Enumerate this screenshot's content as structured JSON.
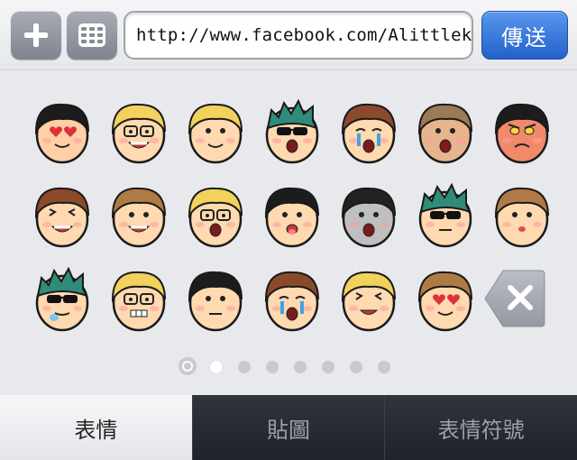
{
  "toolbar": {
    "url_value": "http://www.facebook.com/Alittlekeke",
    "send_label": "傳送"
  },
  "stickers": [
    {
      "hair": "#1c1c1c",
      "skin": "#ffcfa6",
      "expression": "heart-eyes"
    },
    {
      "hair": "#f2d15c",
      "skin": "#ffd9b0",
      "expression": "glasses-laugh"
    },
    {
      "hair": "#f2d15c",
      "skin": "#ffd9b0",
      "expression": "smile"
    },
    {
      "hair": "#2f8b7a",
      "skin": "#ffd9b0",
      "expression": "sunglasses-cry"
    },
    {
      "hair": "#8b4a2b",
      "skin": "#ffd9b0",
      "expression": "crying"
    },
    {
      "hair": "#9b7a55",
      "skin": "#e7b48d",
      "expression": "shock"
    },
    {
      "hair": "#1c1c1c",
      "skin": "#f08a6a",
      "expression": "angry"
    },
    {
      "hair": "#8b4a2b",
      "skin": "#ffd9b0",
      "expression": "laugh"
    },
    {
      "hair": "#b07a45",
      "skin": "#ffd9b0",
      "expression": "grin"
    },
    {
      "hair": "#f2d15c",
      "skin": "#ffd9b0",
      "expression": "glasses-shout"
    },
    {
      "hair": "#1c1c1c",
      "skin": "#ffd9b0",
      "expression": "tongue"
    },
    {
      "hair": "#222222",
      "skin": "#bfbfbf",
      "expression": "scared"
    },
    {
      "hair": "#2f8b7a",
      "skin": "#ffd9b0",
      "expression": "sunglasses"
    },
    {
      "hair": "#b07a45",
      "skin": "#ffd9b0",
      "expression": "kiss"
    },
    {
      "hair": "#2f8b7a",
      "skin": "#ffd9b0",
      "expression": "sunglasses-drool"
    },
    {
      "hair": "#f2d15c",
      "skin": "#ffd9b0",
      "expression": "glasses-grit"
    },
    {
      "hair": "#1c1c1c",
      "skin": "#ffd9b0",
      "expression": "flat"
    },
    {
      "hair": "#8b4a2b",
      "skin": "#ffd9b0",
      "expression": "blue-cry"
    },
    {
      "hair": "#f2d15c",
      "skin": "#ffd9b0",
      "expression": "wink"
    },
    {
      "hair": "#b07a45",
      "skin": "#ffd9b0",
      "expression": "heart-eyes"
    }
  ],
  "delete_key": {
    "icon": "backspace-icon"
  },
  "page_indicator": {
    "pages": 7,
    "current": 1
  },
  "tabs": [
    {
      "label": "表情",
      "selected": true
    },
    {
      "label": "貼圖",
      "selected": false
    },
    {
      "label": "表情符號",
      "selected": false
    }
  ],
  "colors": {
    "send_button": "#2f6fd6",
    "tab_bar": "#222730",
    "grid_bg": "#e8e9ed"
  }
}
